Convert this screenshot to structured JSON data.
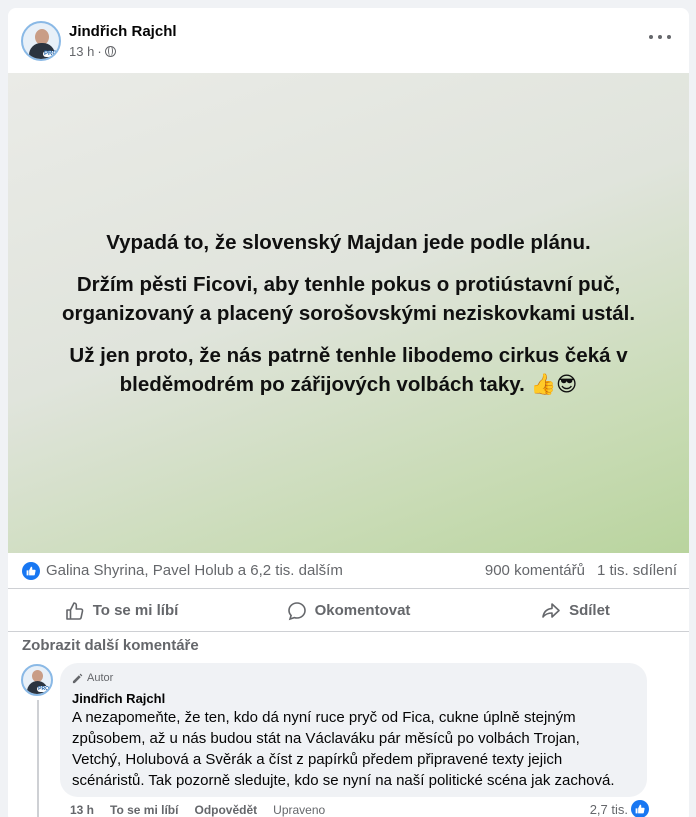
{
  "post": {
    "author": "Jindřich Rajchl",
    "time": "13 h",
    "time_separator": "·",
    "avatar_tag": "PRO",
    "image_text": {
      "p1": "Vypadá to, že slovenský Majdan jede podle plánu.",
      "p2": "Držím pěsti Ficovi, aby tenhle pokus o protiústavní puč, organizovaný a placený sorošovskými neziskovkami ustál.",
      "p3": "Už jen proto, že nás patrně tenhle libodemo cirkus čeká v bleděmodrém po zářijových volbách taky. 👍😎"
    }
  },
  "stats": {
    "reactions": "Galina Shyrina, Pavel Holub a 6,2 tis. dalším",
    "comments": "900 komentářů",
    "shares": "1 tis. sdílení"
  },
  "actions": {
    "like": "To se mi líbí",
    "comment": "Okomentovat",
    "share": "Sdílet"
  },
  "comments_section": {
    "more_label": "Zobrazit další komentáře",
    "comment": {
      "badge": "Autor",
      "author": "Jindřich Rajchl",
      "avatar_tag": "PRO",
      "text": "A nezapomeňte, že ten, kdo dá nyní ruce pryč od Fica, cukne úplně stejným způsobem, až u nás budou stát na Václaváku pár měsíců po volbách Trojan, Vetchý, Holubová a Svěrák a číst z papírků předem připravené texty jejich scénáristů. Tak pozorně sledujte, kdo se nyní na naší politické scéna jak zachová.",
      "time": "13 h",
      "like": "To se mi líbí",
      "reply": "Odpovědět",
      "edited": "Upraveno",
      "reactions": "2,7 tis."
    }
  },
  "colors": {
    "accent": "#1877f2",
    "secondary_text": "#65676b",
    "bubble": "#f0f2f5"
  }
}
